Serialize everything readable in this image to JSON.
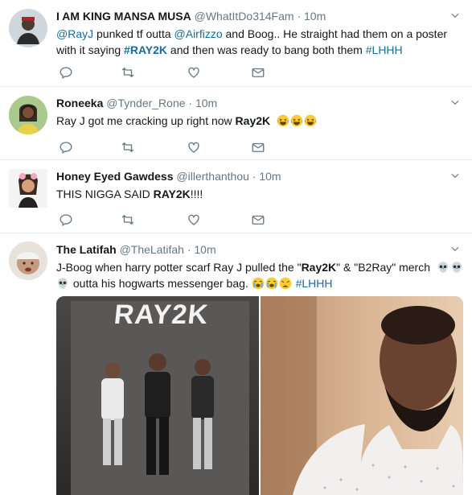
{
  "tweets": [
    {
      "name": "I AM KING MANSA MUSA",
      "handle": "@WhatItDo314Fam",
      "dot": "·",
      "time": "10m",
      "line1": {
        "m1": "@RayJ",
        "t1": " punked tf outta ",
        "m2": "@Airfizzo",
        "t2": " and Boog.. He straight had them on a poster"
      },
      "line2": {
        "t1": "with it saying ",
        "h1": "#RAY2K",
        "t2": " and then was ready to bang both them ",
        "h2": "#LHHH"
      }
    },
    {
      "name": "Roneeka",
      "handle": "@Tynder_Rone",
      "dot": "·",
      "time": "10m",
      "line1": {
        "t1": "Ray J got me cracking up right now ",
        "b1": "Ray2K"
      }
    },
    {
      "name": "Honey Eyed Gawdess",
      "handle": "@illerthanthou",
      "dot": "·",
      "time": "10m",
      "line1": {
        "t1": "THIS NIGGA SAID ",
        "b1": "RAY2K",
        "t2": "!!!!"
      }
    },
    {
      "name": "The Latifah",
      "handle": "@TheLatifah",
      "dot": "·",
      "time": "10m",
      "line1": {
        "t1": "J-Boog when harry potter scarf Ray J pulled the \"",
        "b1": "Ray2K",
        "t2": "\" & \"B2Ray\" merch"
      },
      "line2": {
        "t1": " outta his hogwarts messenger bag. ",
        "h1": "#LHHH"
      },
      "poster_text": "RAY2K"
    }
  ],
  "icons": [
    "reply-icon",
    "retweet-icon",
    "like-icon",
    "direct-message-icon",
    "chevron-down-icon"
  ],
  "colors": {
    "link": "#1b6a99",
    "icon": "#657786",
    "name": "#14171a",
    "divider": "#e6ecf0"
  }
}
